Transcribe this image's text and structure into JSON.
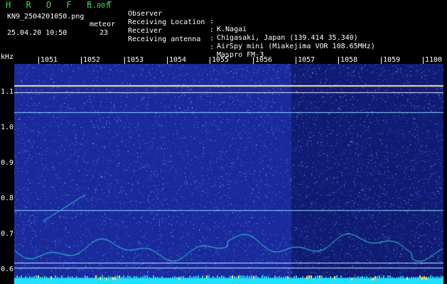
{
  "app": {
    "title": "H R O F F T",
    "version": "1.00f",
    "filename": "KN9_2504201050.png",
    "datetime": "25.04.20 10:50",
    "detector": "meteor",
    "count": "23"
  },
  "info": [
    {
      "key": "Observer",
      "value": "K.Nagai"
    },
    {
      "key": "Receiving Location",
      "value": "Chigasaki, Japan (139.414 35.340)"
    },
    {
      "key": "Receiver",
      "value": "AirSpy mini (Miakejima VOR 108.65MHz)"
    },
    {
      "key": "Receiving antenna",
      "value": "Maspro FM-3"
    }
  ],
  "info_separator": ":",
  "axis": {
    "freq_unit": "kHz",
    "time_labels": [
      "1051",
      "1052",
      "1053",
      "1054",
      "1055",
      "1056",
      "1057",
      "1058",
      "1059",
      "1100"
    ],
    "freq_labels": [
      "1.1",
      "1.0",
      "0.9",
      "0.8",
      "0.7",
      "0.6"
    ]
  },
  "colors": {
    "background": "#1a2a9a",
    "noise": "#5a7aff",
    "carrier": "#e8e8ff",
    "bottom_band": "#20e0ff",
    "signal": "#30d0d0",
    "text": "#ffffff",
    "title_green": "#33dd55"
  }
}
